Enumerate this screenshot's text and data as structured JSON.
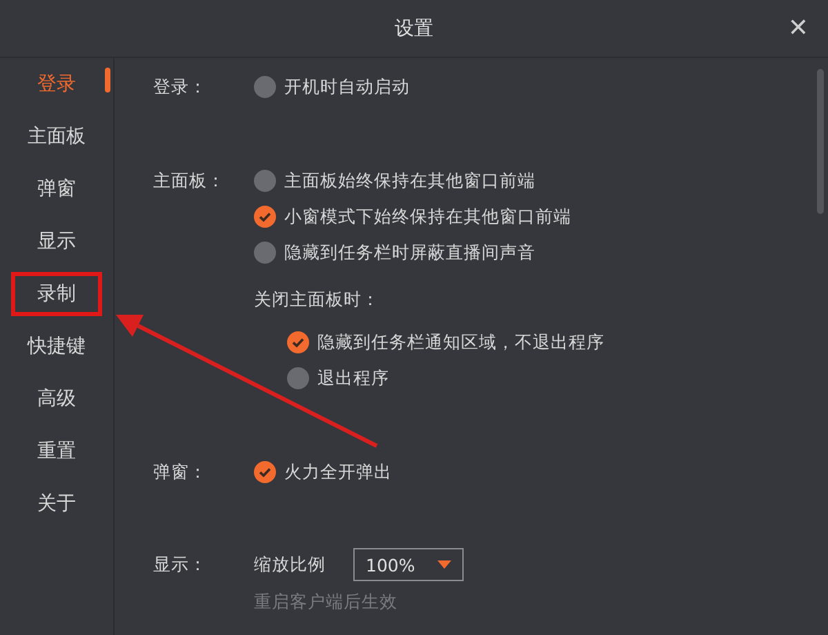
{
  "window": {
    "title": "设置",
    "close": "✕"
  },
  "sidebar": {
    "items": [
      {
        "label": "登录",
        "selected": true,
        "highlighted": false
      },
      {
        "label": "主面板",
        "selected": false,
        "highlighted": false
      },
      {
        "label": "弹窗",
        "selected": false,
        "highlighted": false
      },
      {
        "label": "显示",
        "selected": false,
        "highlighted": false
      },
      {
        "label": "录制",
        "selected": false,
        "highlighted": true
      },
      {
        "label": "快捷键",
        "selected": false,
        "highlighted": false
      },
      {
        "label": "高级",
        "selected": false,
        "highlighted": false
      },
      {
        "label": "重置",
        "selected": false,
        "highlighted": false
      },
      {
        "label": "关于",
        "selected": false,
        "highlighted": false
      }
    ]
  },
  "sections": [
    {
      "label": "登录：",
      "items": [
        {
          "kind": "option",
          "label": "开机时自动启动",
          "checked": false
        }
      ]
    },
    {
      "label": "主面板：",
      "items": [
        {
          "kind": "option",
          "label": "主面板始终保持在其他窗口前端",
          "checked": false
        },
        {
          "kind": "option",
          "label": "小窗模式下始终保持在其他窗口前端",
          "checked": true
        },
        {
          "kind": "option",
          "label": "隐藏到任务栏时屏蔽直播间声音",
          "checked": false
        },
        {
          "kind": "subheading",
          "label": "关闭主面板时：",
          "children": [
            {
              "kind": "option",
              "label": "隐藏到任务栏通知区域，不退出程序",
              "checked": true
            },
            {
              "kind": "option",
              "label": "退出程序",
              "checked": false
            }
          ]
        }
      ]
    },
    {
      "label": "弹窗：",
      "items": [
        {
          "kind": "option",
          "label": "火力全开弹出",
          "checked": true
        }
      ]
    },
    {
      "label": "显示：",
      "items": [
        {
          "kind": "select",
          "label": "缩放比例",
          "value": "100%"
        },
        {
          "kind": "note",
          "label": "重启客户端后生效"
        }
      ]
    }
  ]
}
